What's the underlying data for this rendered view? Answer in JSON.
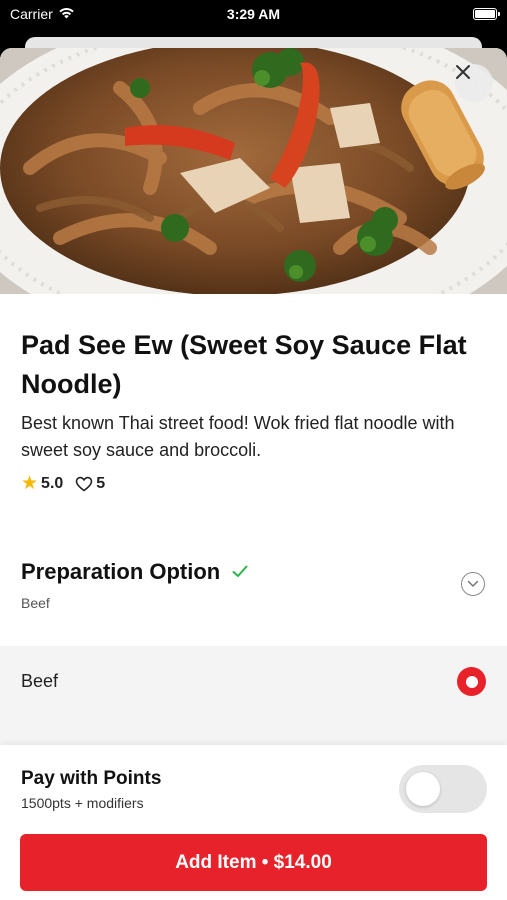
{
  "status_bar": {
    "carrier": "Carrier",
    "time": "3:29 AM"
  },
  "item": {
    "title": "Pad See Ew (Sweet Soy Sauce Flat Noodle)",
    "description": "Best known Thai street food! Wok fried flat noodle with sweet soy sauce and broccoli.",
    "rating": "5.0",
    "likes": "5"
  },
  "preparation": {
    "title": "Preparation Option",
    "selected_value": "Beef",
    "options": [
      {
        "label": "Beef",
        "selected": true
      }
    ]
  },
  "footer": {
    "points_title": "Pay with Points",
    "points_subtitle": "1500pts + modifiers",
    "pay_with_points_enabled": false,
    "add_button_label": "Add Item • $14.00"
  },
  "icons": {
    "close": "close-icon",
    "star": "star-icon",
    "heart": "heart-icon",
    "check": "checkmark-icon",
    "chevron": "chevron-down-icon",
    "wifi": "wifi-icon",
    "battery": "battery-icon"
  },
  "colors": {
    "accent": "#e8222a",
    "check": "#2db34a",
    "star": "#f6b800"
  }
}
